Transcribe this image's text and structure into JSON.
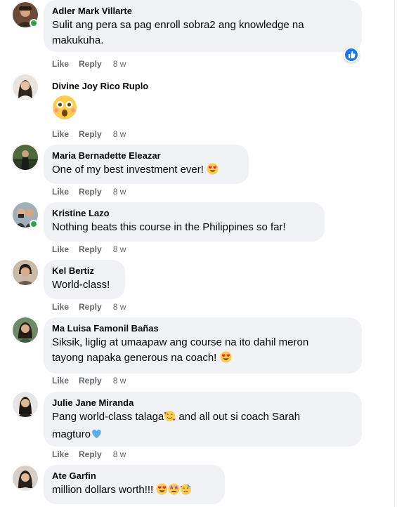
{
  "comments": [
    {
      "name": "Adler Mark Villarte",
      "text_lines": [
        "Sulit ang pera sa pag enroll sobra2 ang knowledge na",
        "makukuha."
      ],
      "like": "Like",
      "reply": "Reply",
      "time": "8 w",
      "reaction_icon": "like-reaction-icon",
      "online": true
    },
    {
      "name": "Divine Joy Rico Ruplo",
      "emoji": "astonished-face-emoji",
      "like": "Like",
      "reply": "Reply",
      "time": "8 w",
      "online": false
    },
    {
      "name": "Maria Bernadette Eleazar",
      "text": "One of my best investment ever!",
      "emoji": "heart-eyes-emoji",
      "like": "Like",
      "reply": "Reply",
      "time": "8 w",
      "online": false
    },
    {
      "name": "Kristine Lazo",
      "text": "Nothing beats this course in the Philippines so far!",
      "like": "Like",
      "reply": "Reply",
      "time": "8 w",
      "online": true
    },
    {
      "name": "Kel Bertiz",
      "text": "World-class!",
      "like": "Like",
      "reply": "Reply",
      "time": "8 w",
      "online": false
    },
    {
      "name": "Ma Luisa Famonil Bañas",
      "text_lines": [
        "Siksik, liglig at umaapaw ang course na ito dahil meron",
        "tayong napaka generous na coach!"
      ],
      "emoji": "heart-eyes-emoji",
      "like": "Like",
      "reply": "Reply",
      "time": "8 w",
      "online": false
    },
    {
      "name": "Julie Jane Miranda",
      "line1_a": "Pang world-class talaga",
      "line1_b": " and all out si coach Sarah",
      "line2": "magturo",
      "emojis": [
        "smiling-face-with-hearts-emoji",
        "blue-heart-emoji"
      ],
      "like": "Like",
      "reply": "Reply",
      "time": "8 w",
      "online": false
    },
    {
      "name": "Ate Garfin",
      "text": "million dollars worth!!!",
      "emojis": [
        "heart-eyes-emoji",
        "star-struck-emoji",
        "partying-face-emoji"
      ],
      "online": false
    }
  ],
  "colors": {
    "bubble": "#f0f2f5",
    "action_text": "#65676b",
    "online": "#31a24c",
    "like_blue": "#1877f2"
  }
}
